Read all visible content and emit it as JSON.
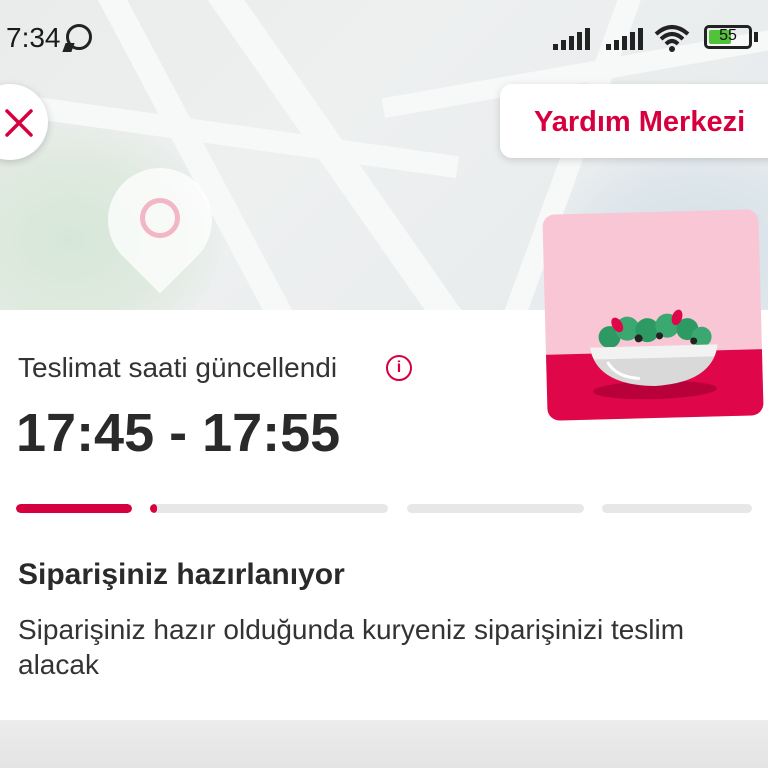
{
  "status_bar": {
    "time": "7:34",
    "battery_level": "55"
  },
  "header": {
    "help_center_label": "Yardım Merkezi"
  },
  "delivery": {
    "label": "Teslimat saati güncellendi",
    "time_range": "17:45 - 17:55",
    "progress_steps": [
      1.0,
      0.03,
      0.0,
      0.0
    ]
  },
  "order_status": {
    "title": "Siparişiniz hazırlanıyor",
    "description": "Siparişiniz hazır olduğunda kuryeniz siparişinizi teslim alacak"
  },
  "colors": {
    "accent": "#d7003e",
    "illustration_bg": "#f8c6d5"
  },
  "icons": {
    "close": "close-icon",
    "info": "info-icon",
    "whatsapp": "whatsapp-icon",
    "wifi": "wifi-icon"
  }
}
